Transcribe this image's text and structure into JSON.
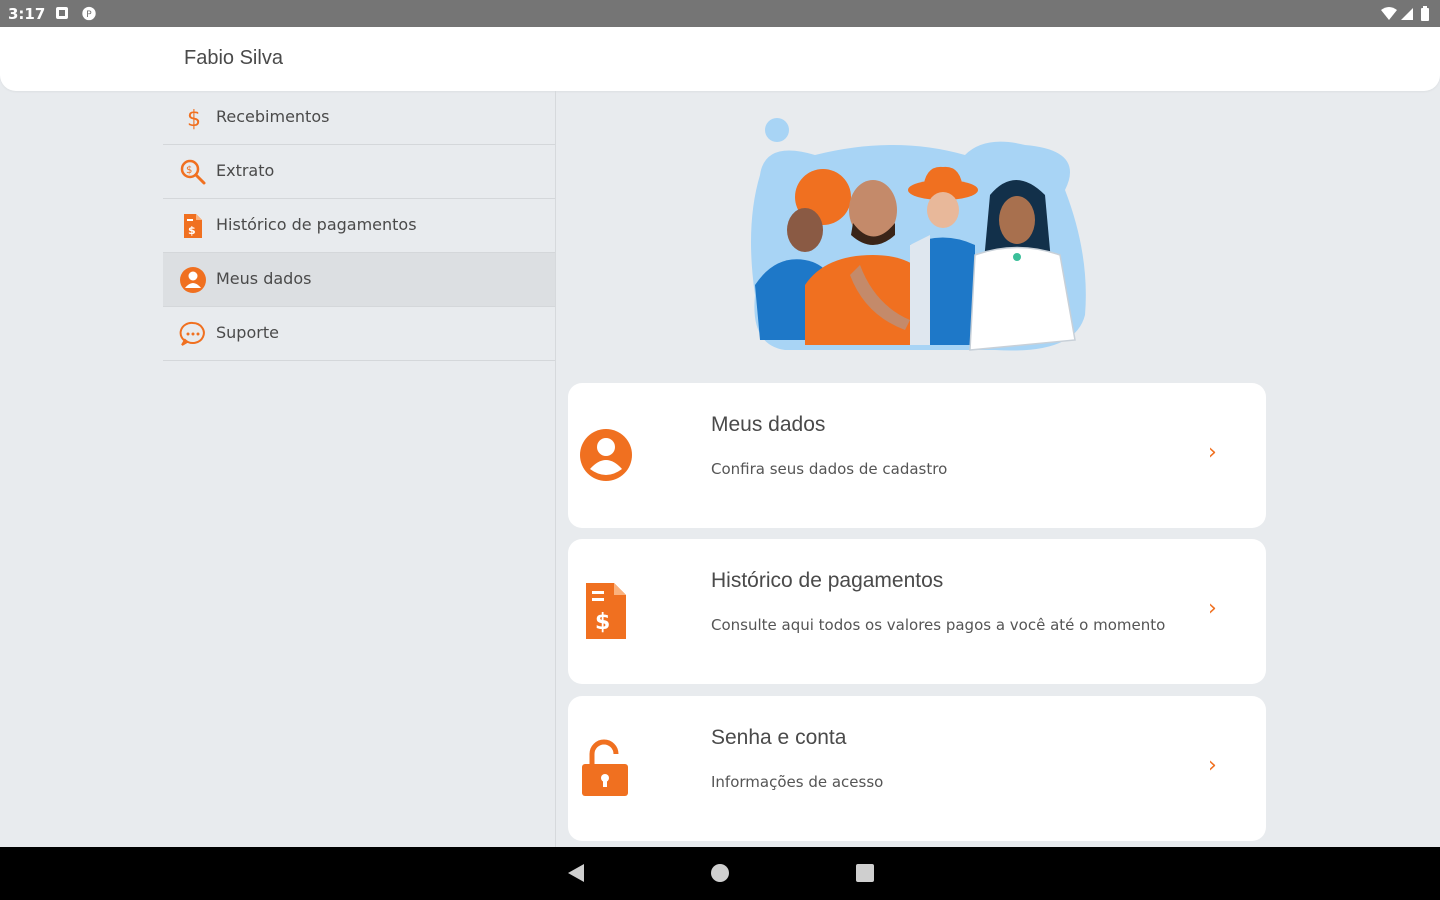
{
  "status_bar": {
    "time": "3:17",
    "icons": [
      "notification-icon",
      "app-icon",
      "wifi-icon",
      "signal-icon",
      "battery-icon"
    ]
  },
  "header": {
    "user_name": "Fabio Silva"
  },
  "sidebar": {
    "items": [
      {
        "label": "Recebimentos",
        "icon": "dollar-icon",
        "active": false
      },
      {
        "label": "Extrato",
        "icon": "search-dollar-icon",
        "active": false
      },
      {
        "label": "Histórico de pagamentos",
        "icon": "document-dollar-icon",
        "active": false
      },
      {
        "label": "Meus dados",
        "icon": "user-icon",
        "active": true
      },
      {
        "label": "Suporte",
        "icon": "chat-icon",
        "active": false
      }
    ]
  },
  "cards": [
    {
      "title": "Meus dados",
      "subtitle": "Confira seus dados de cadastro",
      "icon": "user-circle-icon"
    },
    {
      "title": "Histórico de pagamentos",
      "subtitle": "Consulte aqui todos os valores pagos a você até o momento",
      "icon": "document-dollar-icon"
    },
    {
      "title": "Senha e conta",
      "subtitle": "Informações de acesso",
      "icon": "unlock-icon"
    }
  ],
  "chevron": "›",
  "colors": {
    "accent": "#f07020",
    "background": "#e8ebee",
    "card": "#ffffff",
    "illustration_blue": "#a8d4f5"
  }
}
